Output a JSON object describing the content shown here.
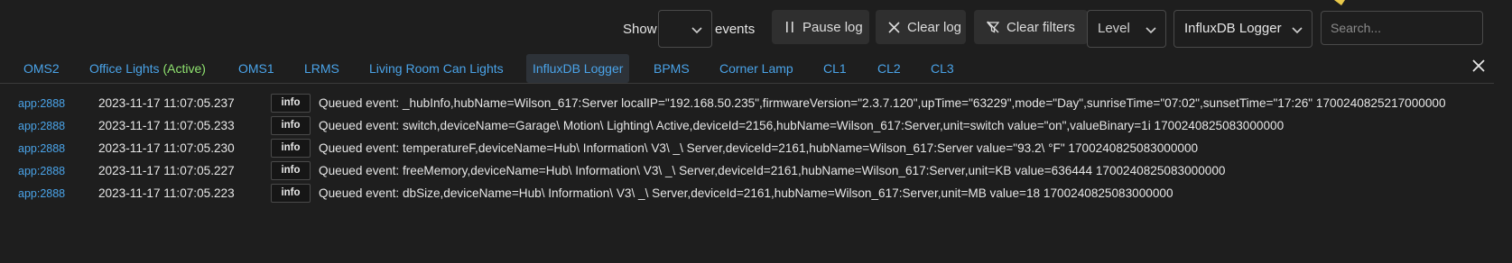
{
  "toolbar": {
    "show_label": "Show",
    "events_label": "events",
    "show_count_value": "",
    "pause_label": "Pause log",
    "clear_label": "Clear log",
    "clear_filters_label": "Clear filters",
    "level_value": "Level",
    "app_filter_value": "InfluxDB Logger",
    "search_placeholder": "Search..."
  },
  "tabs": [
    {
      "label": "OMS2"
    },
    {
      "label": "Office Lights",
      "status": "(Active)"
    },
    {
      "label": "OMS1"
    },
    {
      "label": "LRMS"
    },
    {
      "label": "Living Room Can Lights"
    },
    {
      "label": "InfluxDB Logger",
      "active": true
    },
    {
      "label": "BPMS"
    },
    {
      "label": "Corner Lamp"
    },
    {
      "label": "CL1"
    },
    {
      "label": "CL2"
    },
    {
      "label": "CL3"
    }
  ],
  "log": [
    {
      "source": "app:2888",
      "timestamp": "2023-11-17 11:07:05.237",
      "level": "info",
      "message": "Queued event: _hubInfo,hubName=Wilson_617:Server localIP=\"192.168.50.235\",firmwareVersion=\"2.3.7.120\",upTime=\"63229\",mode=\"Day\",sunriseTime=\"07:02\",sunsetTime=\"17:26\" 1700240825217000000"
    },
    {
      "source": "app:2888",
      "timestamp": "2023-11-17 11:07:05.233",
      "level": "info",
      "message": "Queued event: switch,deviceName=Garage\\ Motion\\ Lighting\\ Active,deviceId=2156,hubName=Wilson_617:Server,unit=switch value=\"on\",valueBinary=1i 1700240825083000000"
    },
    {
      "source": "app:2888",
      "timestamp": "2023-11-17 11:07:05.230",
      "level": "info",
      "message": "Queued event: temperatureF,deviceName=Hub\\ Information\\ V3\\ _\\ Server,deviceId=2161,hubName=Wilson_617:Server value=\"93.2\\ °F\" 1700240825083000000"
    },
    {
      "source": "app:2888",
      "timestamp": "2023-11-17 11:07:05.227",
      "level": "info",
      "message": "Queued event: freeMemory,deviceName=Hub\\ Information\\ V3\\ _\\ Server,deviceId=2161,hubName=Wilson_617:Server,unit=KB value=636444 1700240825083000000"
    },
    {
      "source": "app:2888",
      "timestamp": "2023-11-17 11:07:05.223",
      "level": "info",
      "message": "Queued event: dbSize,deviceName=Hub\\ Information\\ V3\\ _\\ Server,deviceId=2161,hubName=Wilson_617:Server,unit=MB value=18 1700240825083000000"
    }
  ],
  "icons": {
    "pause": "pause-icon",
    "clear": "close-icon",
    "clear_filters": "filter-off-icon",
    "chevron": "chevron-down-icon",
    "close_tabs": "close-icon"
  },
  "colors": {
    "background": "#1e1e1e",
    "link": "#4aa3e8",
    "active_status": "#8fe26f",
    "button_bg": "#2f2f2f",
    "border": "#4a4a4a"
  }
}
